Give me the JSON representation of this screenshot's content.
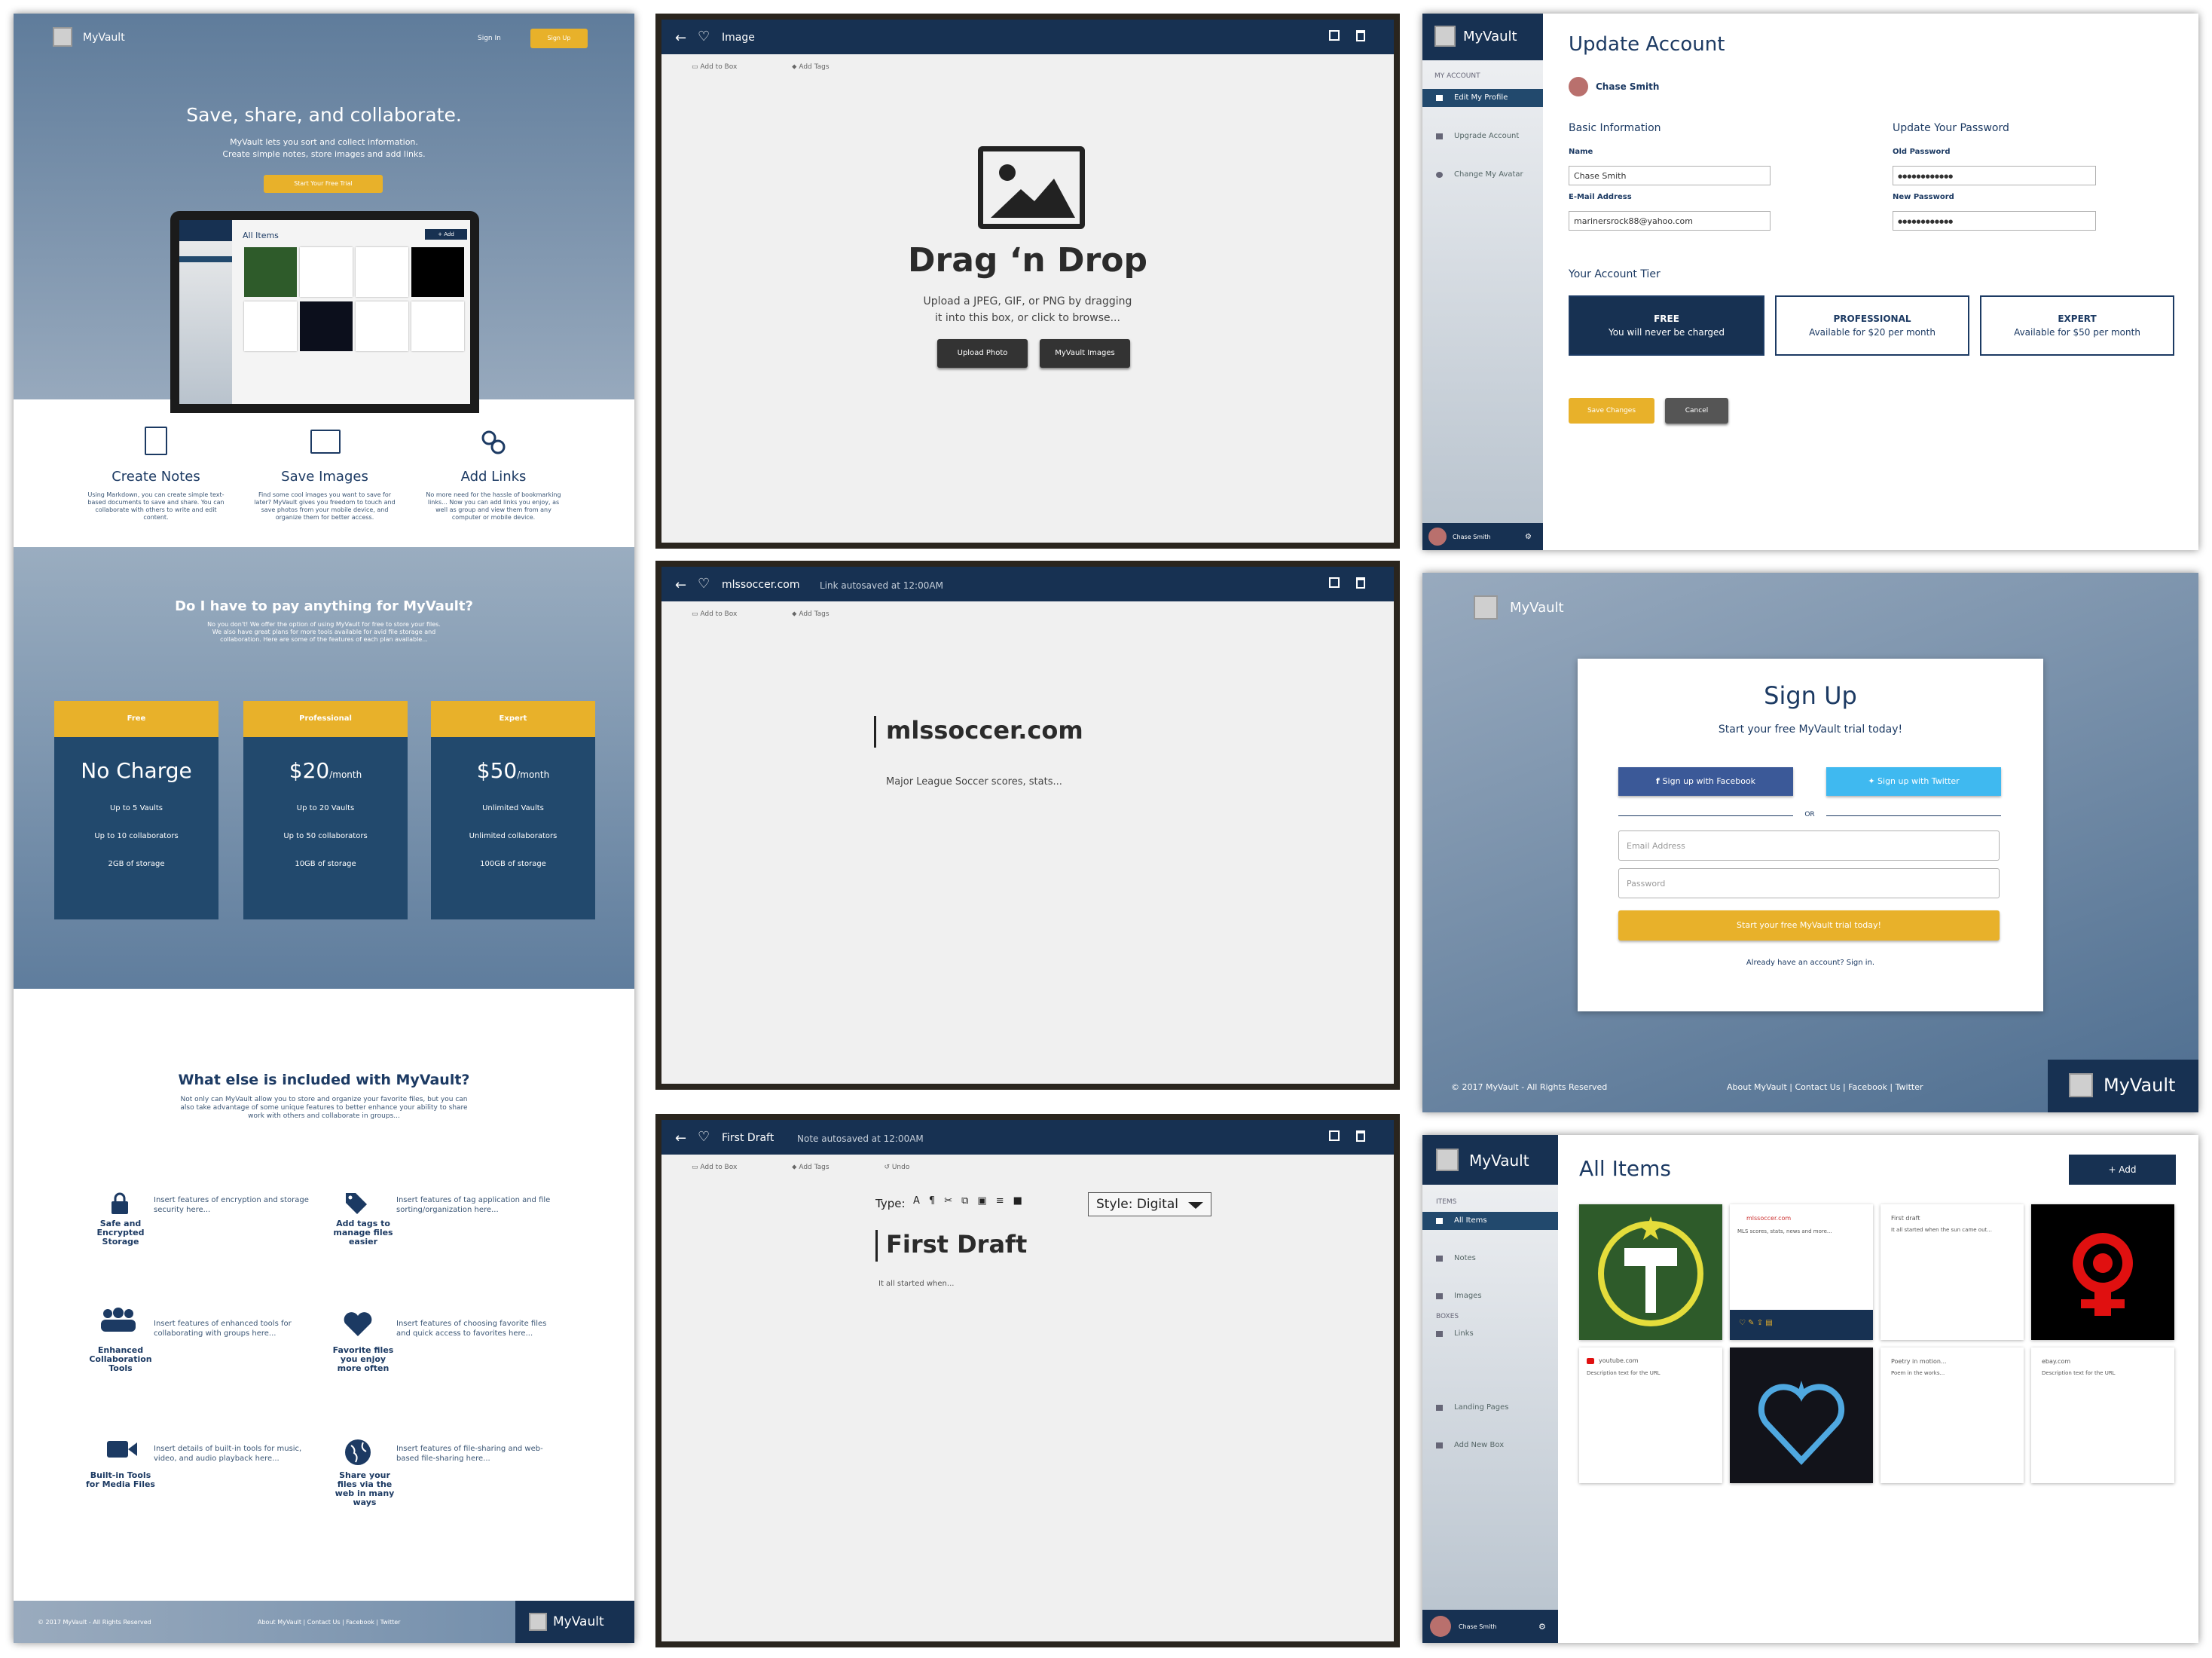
{
  "landing": {
    "brand": "MyVault",
    "nav_signin": "Sign In",
    "nav_signup": "Sign Up",
    "hero_title": "Save, share, and collaborate.",
    "hero_sub1": "MyVault lets you sort and collect information.",
    "hero_sub2": "Create simple notes, store images and add links.",
    "hero_cta": "Start Your Free Trial",
    "mock_title": "All Items",
    "mock_add": "+ Add",
    "features": [
      {
        "title": "Create Notes",
        "desc": "Using Markdown, you can create simple text-based documents to save and share. You can collaborate with others to write and edit content."
      },
      {
        "title": "Save Images",
        "desc": "Find some cool images you want to save for later? MyVault gives you freedom to touch and save photos from your mobile device, and organize them for better access."
      },
      {
        "title": "Add Links",
        "desc": "No more need for the hassle of bookmarking links... Now you can add links you enjoy, as well as group and view them from any computer or mobile device."
      }
    ],
    "pay_title": "Do I have to pay anything for MyVault?",
    "pay_desc": "No you don't! We offer the option of using MyVault for free to store your files. We also have great plans for more tools available for avid file storage and collaboration. Here are some of the features of each plan available...",
    "plans": [
      {
        "name": "Free",
        "price": "No Charge",
        "unit": "",
        "l1": "Up to 5 Vaults",
        "l2": "Up to 10 collaborators",
        "l3": "2GB of storage"
      },
      {
        "name": "Professional",
        "price": "$20",
        "unit": "/month",
        "l1": "Up to 20 Vaults",
        "l2": "Up to 50 collaborators",
        "l3": "10GB of storage"
      },
      {
        "name": "Expert",
        "price": "$50",
        "unit": "/month",
        "l1": "Unlimited Vaults",
        "l2": "Unlimited collaborators",
        "l3": "100GB of storage"
      }
    ],
    "else_title": "What else is included with MyVault?",
    "else_desc": "Not only can MyVault allow you to store and organize your favorite files, but you can also take advantage of some unique features to better enhance your ability to share work with others and collaborate in groups...",
    "extras": [
      {
        "label": "Safe and Encrypted Storage",
        "desc": "Insert features of encryption and storage security here..."
      },
      {
        "label": "Add tags to manage files easier",
        "desc": "Insert features of tag application and file sorting/organization here..."
      },
      {
        "label": "Enhanced Collaboration Tools",
        "desc": "Insert features of enhanced tools for collaborating with groups here..."
      },
      {
        "label": "Favorite files you enjoy more often",
        "desc": "Insert features of choosing favorite files and quick access to favorites here..."
      },
      {
        "label": "Built-in Tools for Media Files",
        "desc": "Insert details of built-in tools for music, video, and audio playback here..."
      },
      {
        "label": "Share your files via the web in many ways",
        "desc": "Insert features of file-sharing and web-based file-sharing here..."
      }
    ],
    "footer_copy": "© 2017 MyVault - All Rights Reserved",
    "footer_links": "About MyVault | Contact Us | Facebook | Twitter"
  },
  "editors": {
    "add_to_box": "Add to Box",
    "add_tags": "Add Tags",
    "undo": "Undo",
    "image": {
      "title": "Image",
      "heading": "Drag ‘n Drop",
      "desc1": "Upload a JPEG, GIF, or PNG by dragging",
      "desc2": "it into this box, or click to browse...",
      "btn_upload": "Upload Photo",
      "btn_myvault": "MyVault Images"
    },
    "link": {
      "title": "mlssoccer.com",
      "status": "Link autosaved at 12:00AM",
      "heading": "mlssoccer.com",
      "desc": "Major League Soccer scores, stats..."
    },
    "note": {
      "title": "First Draft",
      "status": "Note autosaved at 12:00AM",
      "type_label": "Type:",
      "style_label": "Style: Digital",
      "heading": "First Draft",
      "body": "It all started when..."
    }
  },
  "account": {
    "brand": "MyVault",
    "section": "MY ACCOUNT",
    "menu": [
      "Edit My Profile",
      "Upgrade Account",
      "Change My Avatar"
    ],
    "user": "Chase Smith",
    "title": "Update Account",
    "basic": "Basic Information",
    "name_label": "Name",
    "name_value": "Chase Smith",
    "email_label": "E-Mail Address",
    "email_value": "marinersrock88@yahoo.com",
    "pw_title": "Update Your Password",
    "old_label": "Old Password",
    "old_value": "●●●●●●●●●●●●",
    "new_label": "New Password",
    "new_value": "●●●●●●●●●●●●",
    "tier_title": "Your Account Tier",
    "tiers": [
      {
        "name": "FREE",
        "desc": "You will never be charged"
      },
      {
        "name": "PROFESSIONAL",
        "desc": "Available for $20 per month"
      },
      {
        "name": "EXPERT",
        "desc": "Available for $50 per month"
      }
    ],
    "save": "Save Changes",
    "cancel": "Cancel"
  },
  "signup": {
    "brand": "MyVault",
    "title": "Sign Up",
    "subtitle": "Start your free MyVault trial today!",
    "facebook": "Sign up with Facebook",
    "twitter": "Sign up with Twitter",
    "or": "OR",
    "email_ph": "Email Address",
    "password_ph": "Password",
    "cta": "Start your free MyVault trial today!",
    "signin": "Already have an account? Sign in.",
    "footer_copy": "© 2017 MyVault - All Rights Reserved",
    "footer_links": "About MyVault | Contact Us | Facebook | Twitter"
  },
  "items": {
    "brand": "MyVault",
    "title": "All Items",
    "add": "+ Add",
    "sec_items": "ITEMS",
    "menu": [
      "All Items",
      "Notes",
      "Images",
      "Links"
    ],
    "sec_boxes": "BOXES",
    "boxes": [
      "Landing Pages",
      "Add New Box"
    ],
    "user": "Chase Smith",
    "cards": [
      {
        "title": "mlssoccer.com",
        "desc": "MLS scores, stats, news and more..."
      },
      {
        "title": "First draft",
        "desc": "It all started when the sun came out..."
      },
      {
        "title": "youtube.com",
        "desc": "Description text for the URL"
      },
      {
        "title": "Poetry in motion...",
        "desc": "Poem in the works..."
      },
      {
        "title": "ebay.com",
        "desc": "Description text for the URL"
      }
    ]
  }
}
